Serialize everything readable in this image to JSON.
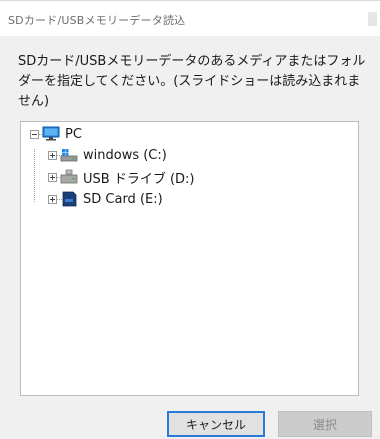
{
  "window": {
    "title": "SDカード/USBメモリーデータ読込"
  },
  "message": "SDカード/USBメモリーデータのあるメディアまたはフォルダーを指定してください。(スライドショーは読み込まれません)",
  "tree": {
    "root": {
      "label": "PC",
      "icon": "pc-monitor-icon",
      "expanded": true
    },
    "children": [
      {
        "label": "windows (C:)",
        "icon": "windows-drive-icon",
        "expanded": false
      },
      {
        "label": "USB ドライブ (D:)",
        "icon": "usb-drive-icon",
        "expanded": false
      },
      {
        "label": "SD Card (E:)",
        "icon": "sd-card-icon",
        "expanded": false
      }
    ]
  },
  "buttons": {
    "cancel": "キャンセル",
    "select": "選択"
  },
  "colors": {
    "focus_border": "#2b7ad6",
    "disabled_text": "#8a8a8a"
  }
}
